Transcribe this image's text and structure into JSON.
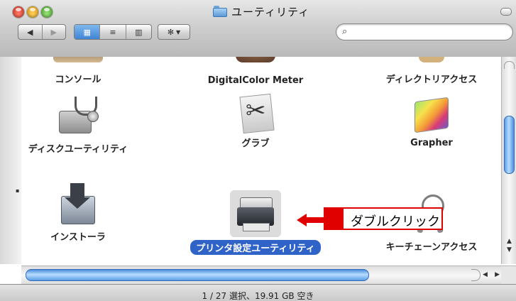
{
  "window": {
    "title": "ユーティリティ",
    "status": "1 / 27 選択、19.91 GB 空き"
  },
  "toolbar": {
    "back_icon": "◀",
    "forward_icon": "▶",
    "view_icons": "icon-view",
    "list_icons": "list-view",
    "column_icons": "column-view",
    "action_icon": "gear-icon",
    "search_placeholder": ""
  },
  "items": [
    {
      "label": "コンソール"
    },
    {
      "label": "DigitalColor Meter"
    },
    {
      "label": "ディレクトリアクセス"
    },
    {
      "label": "ディスクユーティリティ"
    },
    {
      "label": "グラブ"
    },
    {
      "label": "Grapher"
    },
    {
      "label": "インストーラ"
    },
    {
      "label": "プリンタ設定ユーティリティ",
      "selected": true
    },
    {
      "label": "キーチェーンアクセス"
    }
  ],
  "callout": {
    "text": "ダブルクリック",
    "color": "#e00000"
  },
  "colors": {
    "selection": "#2f63c8",
    "scroll_thumb": "#5a9ee6"
  }
}
